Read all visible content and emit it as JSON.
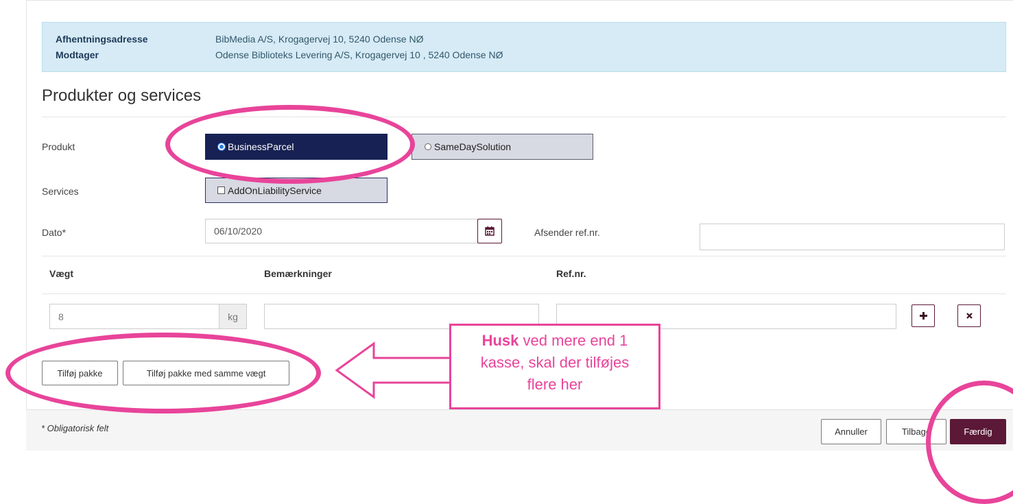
{
  "info": {
    "pickup_label": "Afhentningsadresse",
    "pickup_value": "BibMedia A/S, Krogagervej 10, 5240 Odense NØ",
    "receiver_label": "Modtager",
    "receiver_value": "Odense Biblioteks Levering A/S, Krogagervej 10 , 5240 Odense NØ"
  },
  "section_title": "Produkter og services",
  "product": {
    "label": "Produkt",
    "options": [
      "BusinessParcel",
      "SameDaySolution"
    ],
    "selected": "BusinessParcel"
  },
  "services": {
    "label": "Services",
    "option": "AddOnLiabilityService"
  },
  "date": {
    "label": "Dato*",
    "value": "06/10/2020",
    "icon": "calendar-icon"
  },
  "sender_ref": {
    "label": "Afsender ref.nr.",
    "value": ""
  },
  "table": {
    "headers": [
      "Vægt",
      "Bemærkninger",
      "Ref.nr."
    ],
    "row": {
      "weight": "8",
      "unit": "kg",
      "remarks": "",
      "ref": ""
    },
    "add_icon": "plus-icon",
    "remove_icon": "close-icon"
  },
  "buttons": {
    "add_package": "Tilføj pakke",
    "add_package_same_weight": "Tilføj pakke med samme vægt",
    "cancel": "Annuller",
    "back": "Tilbage",
    "finish": "Færdig"
  },
  "footer": {
    "required_note": "* Obligatorisk felt"
  },
  "callout": {
    "bold": "Husk",
    "line1_rest": " ved mere end 1",
    "line2": "kasse, skal der tilføjes",
    "line3": "flere her"
  },
  "colors": {
    "annotation": "#e8449a",
    "selected_product": "#172153",
    "primary_button": "#5b1837",
    "info_background": "#d6ebf5"
  }
}
